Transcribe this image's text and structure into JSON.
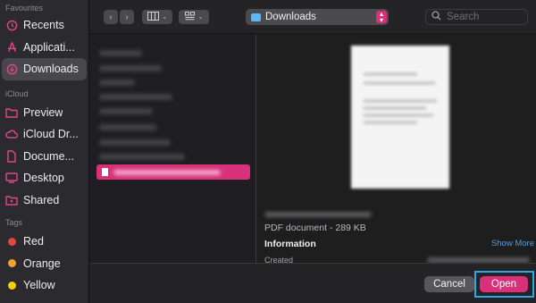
{
  "sidebar": {
    "favourites_header": "Favourites",
    "icloud_header": "iCloud",
    "tags_header": "Tags",
    "favourites": [
      {
        "label": "Recents",
        "icon": "clock-icon"
      },
      {
        "label": "Applicati...",
        "icon": "applications-icon"
      },
      {
        "label": "Downloads",
        "icon": "download-icon",
        "selected": true
      }
    ],
    "icloud": [
      {
        "label": "Preview",
        "icon": "folder-icon"
      },
      {
        "label": "iCloud Dr...",
        "icon": "cloud-icon"
      },
      {
        "label": "Docume...",
        "icon": "document-icon"
      },
      {
        "label": "Desktop",
        "icon": "desktop-icon"
      },
      {
        "label": "Shared",
        "icon": "shared-folder-icon"
      }
    ],
    "tags": [
      {
        "label": "Red",
        "color": "#e8453c"
      },
      {
        "label": "Orange",
        "color": "#f0a22e"
      },
      {
        "label": "Yellow",
        "color": "#f5d000"
      }
    ]
  },
  "toolbar": {
    "location": "Downloads",
    "search_placeholder": "Search",
    "icons": [
      "back-icon",
      "forward-icon",
      "column-view-icon",
      "group-icon"
    ]
  },
  "preview": {
    "file_type": "PDF document - 289 KB",
    "info_heading": "Information",
    "show_more": "Show More",
    "created_label": "Created"
  },
  "buttons": {
    "cancel": "Cancel",
    "open": "Open"
  },
  "colors": {
    "accent": "#d8317a",
    "highlight": "#2ba8e8",
    "link": "#4a9ee8"
  }
}
